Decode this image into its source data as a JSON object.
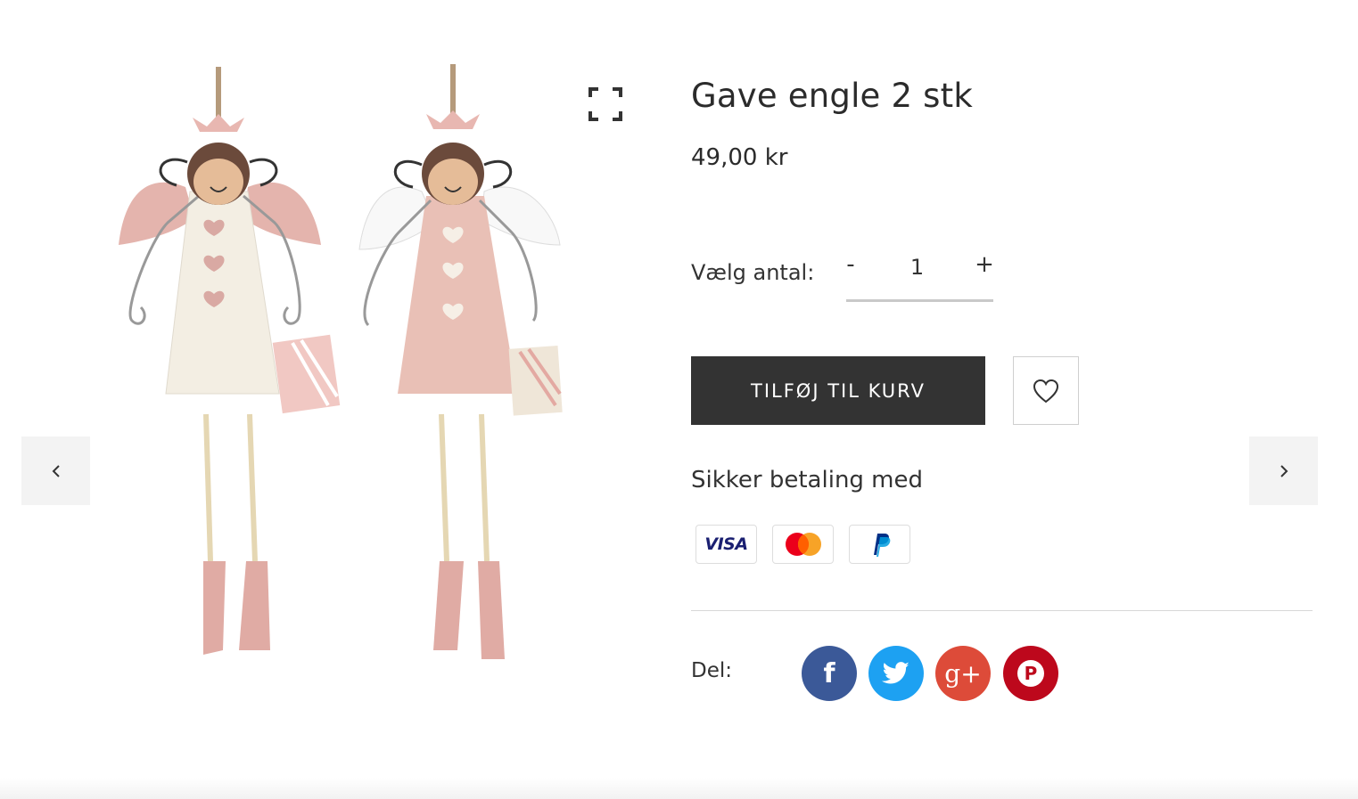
{
  "product": {
    "title": "Gave engle 2 stk",
    "price": "49,00 kr"
  },
  "gallery": {
    "prev_icon": "chevron-left-icon",
    "next_icon": "chevron-right-icon",
    "fullscreen_icon": "fullscreen-icon"
  },
  "quantity": {
    "label": "Vælg antal:",
    "minus": "-",
    "plus": "+",
    "value": "1"
  },
  "actions": {
    "add_to_cart": "TILFØJ TIL KURV",
    "wishlist_icon": "heart-icon"
  },
  "payment": {
    "heading": "Sikker betaling med",
    "methods": [
      {
        "name": "Visa",
        "text": "VISA",
        "color": "#1a1f71"
      },
      {
        "name": "Mastercard",
        "colors": [
          "#eb001b",
          "#f79e1b"
        ]
      },
      {
        "name": "PayPal",
        "colors": [
          "#003087",
          "#009cde"
        ]
      }
    ]
  },
  "share": {
    "label": "Del:",
    "networks": [
      {
        "name": "facebook",
        "glyph": "f",
        "color": "#3b5998"
      },
      {
        "name": "twitter",
        "color": "#1da1f2"
      },
      {
        "name": "google-plus",
        "glyph": "g+",
        "color": "#dd4b39"
      },
      {
        "name": "pinterest",
        "glyph": "P",
        "color": "#bd081c"
      }
    ]
  }
}
